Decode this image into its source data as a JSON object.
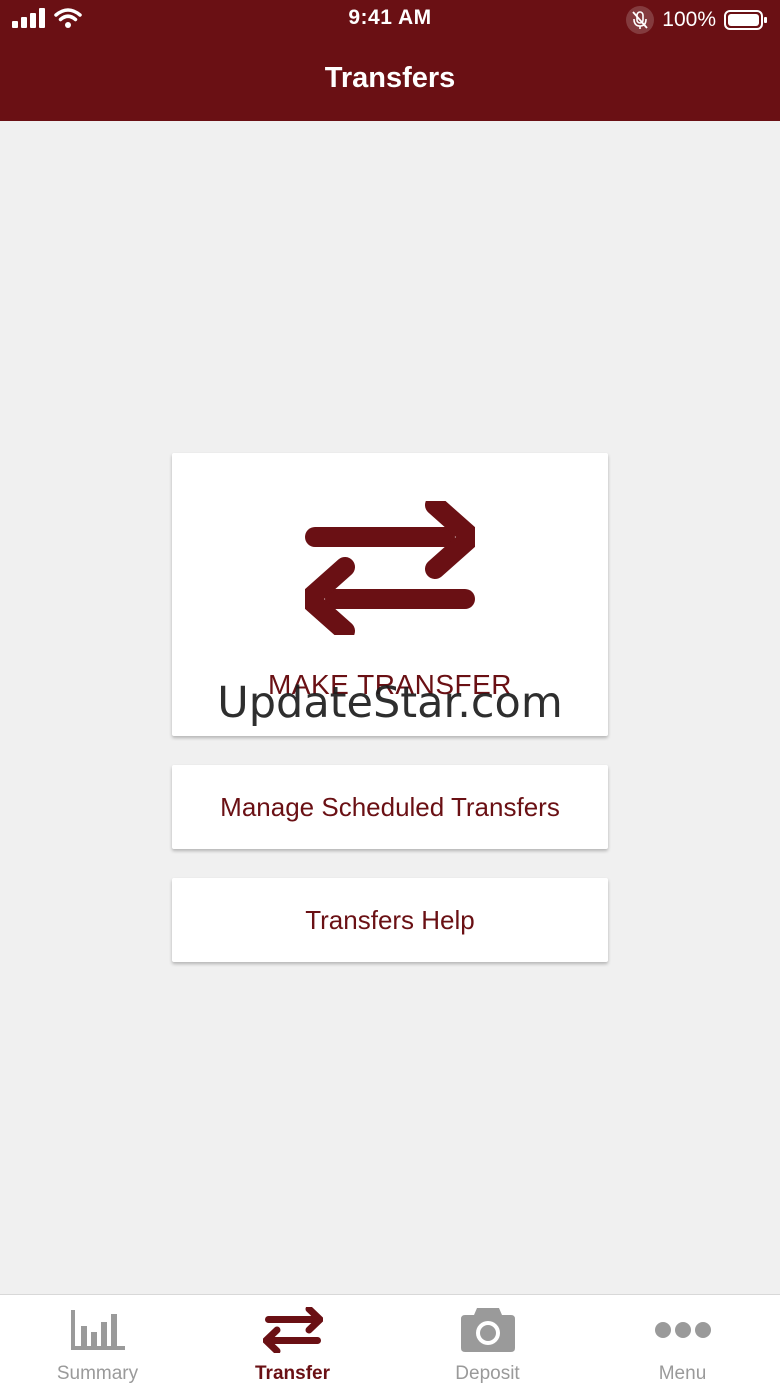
{
  "status_bar": {
    "time": "9:41 AM",
    "battery": "100%"
  },
  "header": {
    "title": "Transfers"
  },
  "main": {
    "make_transfer_label": "MAKE TRANSFER",
    "watermark": "UpdateStar.com",
    "manage_label": "Manage Scheduled Transfers",
    "help_label": "Transfers Help"
  },
  "tabs": [
    {
      "label": "Summary",
      "icon": "bar-chart-icon",
      "active": false
    },
    {
      "label": "Transfer",
      "icon": "transfer-arrows-icon",
      "active": true
    },
    {
      "label": "Deposit",
      "icon": "camera-icon",
      "active": false
    },
    {
      "label": "Menu",
      "icon": "more-dots-icon",
      "active": false
    }
  ],
  "colors": {
    "brand": "#6a1014",
    "background": "#f0f0f0",
    "inactive_tab": "#9a9a9a"
  }
}
